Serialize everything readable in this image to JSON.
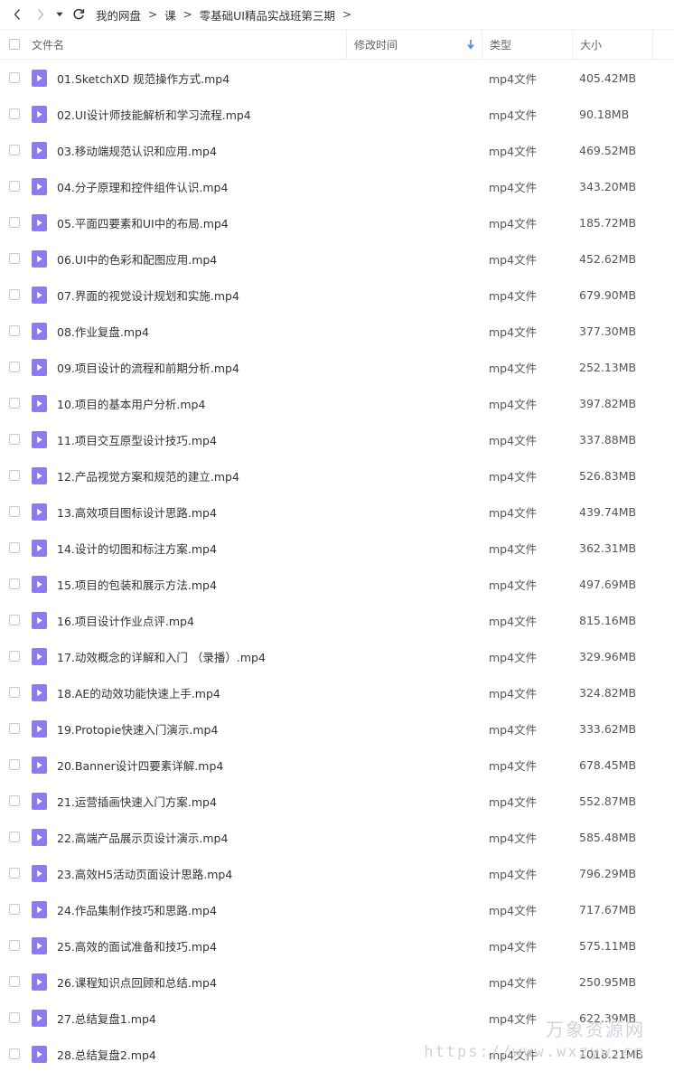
{
  "breadcrumb": [
    "我的网盘",
    "课",
    "零基础UI精品实战班第三期"
  ],
  "breadcrumb_separator": ">",
  "columns": {
    "name": "文件名",
    "time": "修改时间",
    "type": "类型",
    "size": "大小"
  },
  "files": [
    {
      "name": "01.SketchXD 规范操作方式.mp4",
      "type": "mp4文件",
      "size": "405.42MB"
    },
    {
      "name": "02.UI设计师技能解析和学习流程.mp4",
      "type": "mp4文件",
      "size": "90.18MB"
    },
    {
      "name": "03.移动端规范认识和应用.mp4",
      "type": "mp4文件",
      "size": "469.52MB"
    },
    {
      "name": "04.分子原理和控件组件认识.mp4",
      "type": "mp4文件",
      "size": "343.20MB"
    },
    {
      "name": "05.平面四要素和UI中的布局.mp4",
      "type": "mp4文件",
      "size": "185.72MB"
    },
    {
      "name": "06.UI中的色彩和配图应用.mp4",
      "type": "mp4文件",
      "size": "452.62MB"
    },
    {
      "name": "07.界面的视觉设计规划和实施.mp4",
      "type": "mp4文件",
      "size": "679.90MB"
    },
    {
      "name": "08.作业复盘.mp4",
      "type": "mp4文件",
      "size": "377.30MB"
    },
    {
      "name": "09.项目设计的流程和前期分析.mp4",
      "type": "mp4文件",
      "size": "252.13MB"
    },
    {
      "name": "10.项目的基本用户分析.mp4",
      "type": "mp4文件",
      "size": "397.82MB"
    },
    {
      "name": "11.项目交互原型设计技巧.mp4",
      "type": "mp4文件",
      "size": "337.88MB"
    },
    {
      "name": "12.产品视觉方案和规范的建立.mp4",
      "type": "mp4文件",
      "size": "526.83MB"
    },
    {
      "name": "13.高效项目图标设计思路.mp4",
      "type": "mp4文件",
      "size": "439.74MB"
    },
    {
      "name": "14.设计的切图和标注方案.mp4",
      "type": "mp4文件",
      "size": "362.31MB"
    },
    {
      "name": "15.项目的包装和展示方法.mp4",
      "type": "mp4文件",
      "size": "497.69MB"
    },
    {
      "name": "16.项目设计作业点评.mp4",
      "type": "mp4文件",
      "size": "815.16MB"
    },
    {
      "name": "17.动效概念的详解和入门 （录播）.mp4",
      "type": "mp4文件",
      "size": "329.96MB"
    },
    {
      "name": "18.AE的动效功能快速上手.mp4",
      "type": "mp4文件",
      "size": "324.82MB"
    },
    {
      "name": "19.Protopie快速入门演示.mp4",
      "type": "mp4文件",
      "size": "333.62MB"
    },
    {
      "name": "20.Banner设计四要素详解.mp4",
      "type": "mp4文件",
      "size": "678.45MB"
    },
    {
      "name": "21.运营插画快速入门方案.mp4",
      "type": "mp4文件",
      "size": "552.87MB"
    },
    {
      "name": "22.高端产品展示页设计演示.mp4",
      "type": "mp4文件",
      "size": "585.48MB"
    },
    {
      "name": "23.高效H5活动页面设计思路.mp4",
      "type": "mp4文件",
      "size": "796.29MB"
    },
    {
      "name": "24.作品集制作技巧和思路.mp4",
      "type": "mp4文件",
      "size": "717.67MB"
    },
    {
      "name": "25.高效的面试准备和技巧.mp4",
      "type": "mp4文件",
      "size": "575.11MB"
    },
    {
      "name": "26.课程知识点回顾和总结.mp4",
      "type": "mp4文件",
      "size": "250.95MB"
    },
    {
      "name": "27.总结复盘1.mp4",
      "type": "mp4文件",
      "size": "622.39MB"
    },
    {
      "name": "28.总结复盘2.mp4",
      "type": "mp4文件",
      "size": "1018.21MB"
    }
  ],
  "watermark": {
    "title": "万象资源网",
    "url": "https://www.wxzyw.cn"
  },
  "colors": {
    "file_icon": "#8a7cf0",
    "sort_arrow": "#3b8cf5",
    "border": "#eceef2"
  },
  "icons": {
    "back": "chevron-left-icon",
    "forward": "chevron-right-icon",
    "dropdown": "caret-down-icon",
    "refresh": "refresh-icon",
    "sort": "arrow-down-icon",
    "file": "video-file-icon"
  }
}
